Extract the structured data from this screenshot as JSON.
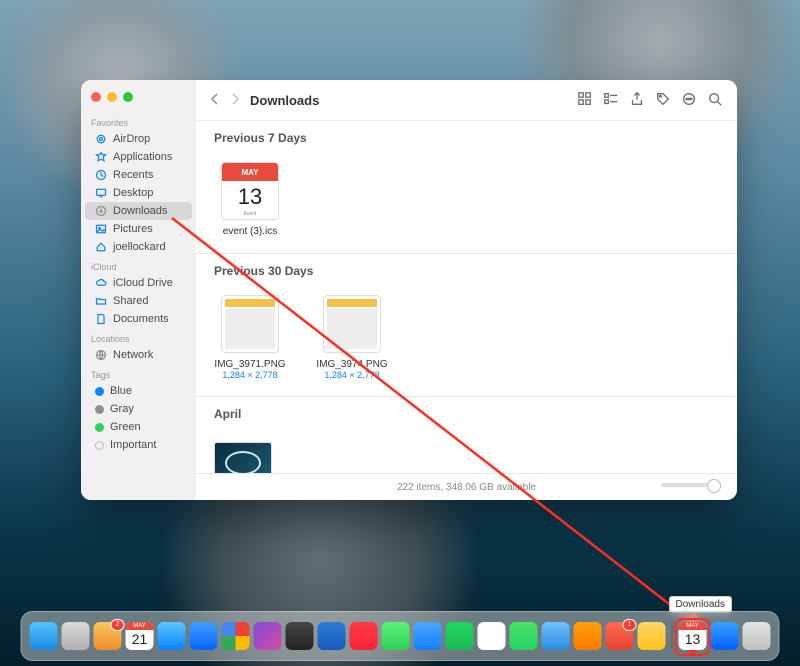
{
  "window": {
    "title": "Downloads"
  },
  "sidebar": {
    "groups": [
      {
        "label": "Favorites",
        "items": [
          {
            "label": "AirDrop"
          },
          {
            "label": "Applications"
          },
          {
            "label": "Recents"
          },
          {
            "label": "Desktop"
          },
          {
            "label": "Downloads",
            "selected": true
          },
          {
            "label": "Pictures"
          },
          {
            "label": "joellockard"
          }
        ]
      },
      {
        "label": "iCloud",
        "items": [
          {
            "label": "iCloud Drive"
          },
          {
            "label": "Shared"
          },
          {
            "label": "Documents"
          }
        ]
      },
      {
        "label": "Locations",
        "items": [
          {
            "label": "Network"
          }
        ]
      },
      {
        "label": "Tags",
        "items": [
          {
            "label": "Blue",
            "color": "#0a84ff"
          },
          {
            "label": "Gray",
            "color": "#8e8e93"
          },
          {
            "label": "Green",
            "color": "#30d158"
          },
          {
            "label": "Important",
            "color": ""
          }
        ]
      }
    ]
  },
  "sections": [
    {
      "heading": "Previous 7 Days",
      "files": [
        {
          "name": "event (3).ics",
          "meta": "",
          "cal_month": "MAY",
          "cal_day": "13"
        }
      ]
    },
    {
      "heading": "Previous 30 Days",
      "files": [
        {
          "name": "IMG_3971.PNG",
          "meta": "1,284 × 2,778"
        },
        {
          "name": "IMG_3974.PNG",
          "meta": "1,284 × 2,778"
        }
      ]
    },
    {
      "heading": "April",
      "files": []
    }
  ],
  "statusbar": {
    "text": "222 items, 348.06 GB available"
  },
  "tooltip": {
    "text": "Downloads"
  },
  "dock": {
    "apps_left": [
      {
        "name": "finder",
        "bg": "linear-gradient(#4ec3ff,#1a8be0)"
      },
      {
        "name": "launchpad",
        "bg": "linear-gradient(#d8d8d8,#b2b2b2)"
      },
      {
        "name": "spark",
        "bg": "linear-gradient(#f9c85a,#f08b2d)",
        "badge": "2"
      },
      {
        "name": "fantastical",
        "bg": "#fff",
        "cal_month": "MAY",
        "cal_day": "21"
      },
      {
        "name": "safari",
        "bg": "linear-gradient(#5ac8fa,#0a84ff)"
      },
      {
        "name": "appstore",
        "bg": "linear-gradient(#3aa0ff,#0a63ff)"
      },
      {
        "name": "chrome",
        "bg": "conic-gradient(#ea4335 0 90deg,#fbbc05 90deg 180deg,#34a853 180deg 270deg,#4285f4 270deg 360deg)"
      },
      {
        "name": "orion",
        "bg": "linear-gradient(135deg,#7b4bd8,#d84ba8)"
      },
      {
        "name": "screenshot",
        "bg": "linear-gradient(#444,#222)"
      },
      {
        "name": "word",
        "bg": "linear-gradient(#2b7cd3,#185abd)"
      },
      {
        "name": "music",
        "bg": "linear-gradient(#fc3c44,#fa233b)"
      },
      {
        "name": "messages",
        "bg": "linear-gradient(#5af27a,#30d158)"
      },
      {
        "name": "xcode",
        "bg": "linear-gradient(#4aa8ff,#147efb)"
      },
      {
        "name": "spotify",
        "bg": "linear-gradient(#1ed760,#1db954)"
      },
      {
        "name": "notion",
        "bg": "#fff"
      },
      {
        "name": "whatsapp",
        "bg": "linear-gradient(#4ce266,#25d366)"
      },
      {
        "name": "finder2",
        "bg": "linear-gradient(#6ec3ff,#2a8be0)"
      },
      {
        "name": "books",
        "bg": "linear-gradient(#ff9f0a,#ff7a00)"
      },
      {
        "name": "todoist",
        "bg": "linear-gradient(#ff6a4d,#e44332)",
        "badge": "1"
      },
      {
        "name": "tot",
        "bg": "linear-gradient(#ffd66b,#ffc21a)"
      }
    ],
    "apps_right": [
      {
        "name": "downloads-stack",
        "bg": "#fff",
        "cal_month": "MAY",
        "cal_day": "13",
        "highlight": true
      },
      {
        "name": "dropbox",
        "bg": "linear-gradient(#3aa0ff,#0061ff)"
      },
      {
        "name": "trash",
        "bg": "linear-gradient(#e5e5e5,#bfbfbf)"
      }
    ]
  }
}
